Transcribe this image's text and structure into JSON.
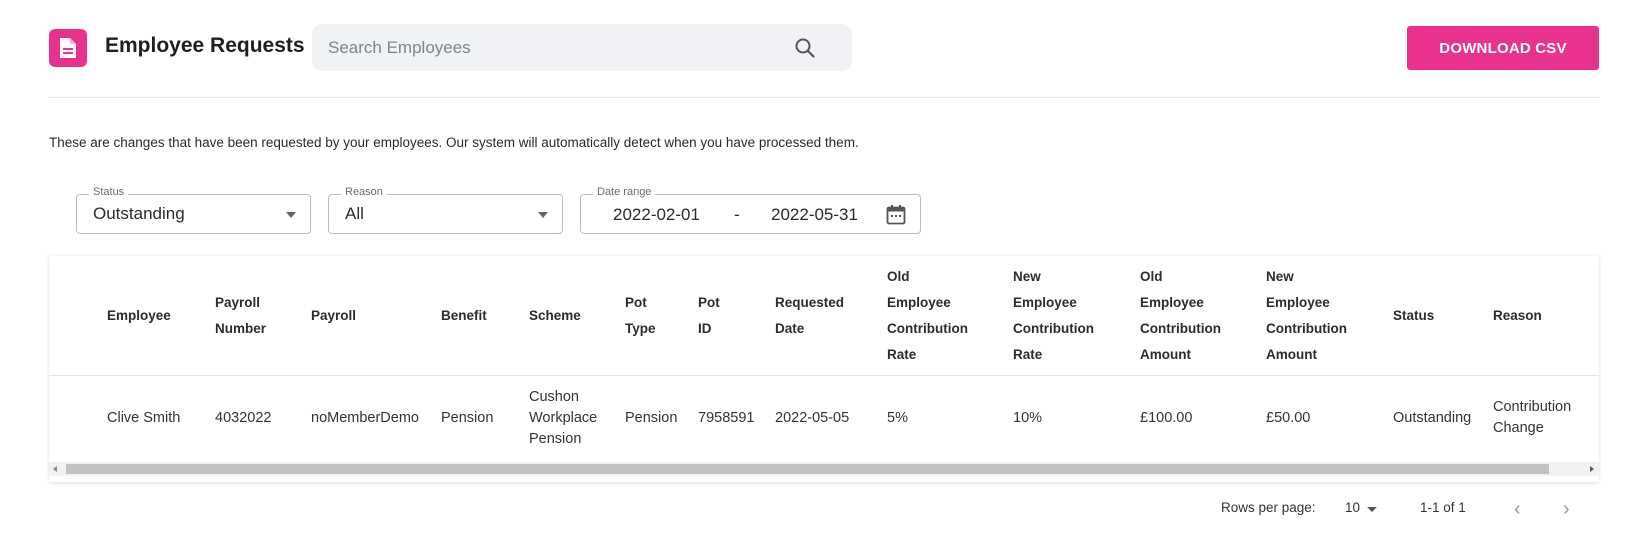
{
  "header": {
    "title": "Employee Requests",
    "search_placeholder": "Search Employees",
    "download_label": "DOWNLOAD CSV",
    "accent_color": "#e8328e",
    "icons": {
      "app": "document-icon",
      "search": "search-icon"
    }
  },
  "description": "These are changes that have been requested by your employees. Our system will automatically detect when you have processed them.",
  "filters": {
    "status": {
      "label": "Status",
      "value": "Outstanding"
    },
    "reason": {
      "label": "Reason",
      "value": "All"
    },
    "date_range": {
      "label": "Date range",
      "from": "2022-02-01",
      "separator": "-",
      "to": "2022-05-31",
      "icon": "calendar-icon"
    }
  },
  "table": {
    "columns": [
      [
        "Employee"
      ],
      [
        "Payroll",
        "Number"
      ],
      [
        "Payroll"
      ],
      [
        "Benefit"
      ],
      [
        "Scheme"
      ],
      [
        "Pot",
        "Type"
      ],
      [
        "Pot",
        "ID"
      ],
      [
        "Requested",
        "Date"
      ],
      [
        "Old",
        "Employee",
        "Contribution",
        "Rate"
      ],
      [
        "New",
        "Employee",
        "Contribution",
        "Rate"
      ],
      [
        "Old",
        "Employee",
        "Contribution",
        "Amount"
      ],
      [
        "New",
        "Employee",
        "Contribution",
        "Amount"
      ],
      [
        "Status"
      ],
      [
        "Reason"
      ]
    ],
    "rows": [
      {
        "employee": "Clive Smith",
        "payroll_number": "4032022",
        "payroll": "noMemberDemo",
        "benefit": "Pension",
        "scheme": [
          "Cushon",
          "Workplace",
          "Pension"
        ],
        "pot_type": "Pension",
        "pot_id": "7958591",
        "requested_date": "2022-05-05",
        "old_rate": "5%",
        "new_rate": "10%",
        "old_amount": "£100.00",
        "new_amount": "£50.00",
        "status": "Outstanding",
        "reason": [
          "Contribution",
          "Change"
        ]
      }
    ]
  },
  "pagination": {
    "rows_per_page_label": "Rows per page:",
    "rows_per_page": "10",
    "range": "1-1 of 1",
    "prev": "‹",
    "next": "›"
  }
}
